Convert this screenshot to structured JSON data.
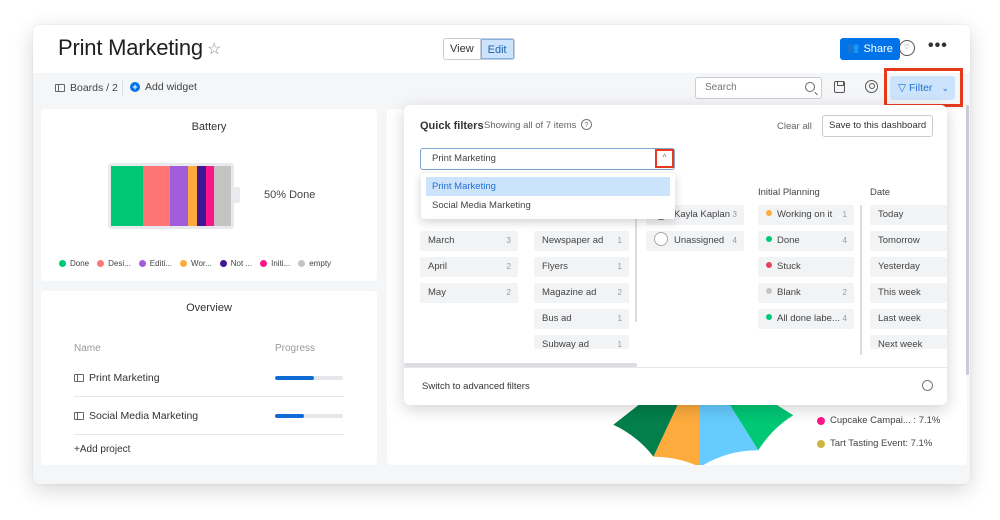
{
  "header": {
    "title": "Print Marketing",
    "view_label": "View",
    "edit_label": "Edit",
    "share_label": "Share"
  },
  "toolbar": {
    "boards_label": "Boards / 2",
    "add_widget_label": "Add widget",
    "search_placeholder": "Search",
    "filter_label": "Filter"
  },
  "battery_widget": {
    "title": "Battery",
    "done_label": "50% Done",
    "segments": [
      {
        "name": "Done",
        "color": "#00c875",
        "share": 0.27
      },
      {
        "name": "Desi...",
        "color": "#ff7575",
        "share": 0.22
      },
      {
        "name": "Editi...",
        "color": "#a25ddc",
        "share": 0.15
      },
      {
        "name": "Wor...",
        "color": "#fdab3d",
        "share": 0.08
      },
      {
        "name": "Not ...",
        "color": "#401694",
        "share": 0.07
      },
      {
        "name": "Initi...",
        "color": "#ff158a",
        "share": 0.07
      },
      {
        "name": "empty",
        "color": "#c4c4c4",
        "share": 0.14
      }
    ]
  },
  "overview_widget": {
    "title": "Overview",
    "col_name": "Name",
    "col_progress": "Progress",
    "rows": [
      {
        "name": "Print Marketing",
        "progress": 0.58
      },
      {
        "name": "Social Media Marketing",
        "progress": 0.43
      }
    ],
    "add_project_label": "+Add project"
  },
  "pie_widget": {
    "legend": [
      {
        "label": "Cupcake Campai... : 7.1%",
        "color": "#ff158a"
      },
      {
        "label": "Tart Tasting Event: 7.1%",
        "color": "#cab641"
      }
    ],
    "visible_slices": [
      {
        "color": "#037f4c"
      },
      {
        "color": "#fdab3d"
      },
      {
        "color": "#66ccff"
      },
      {
        "color": "#00c875"
      }
    ]
  },
  "quick_filters": {
    "title": "Quick filters",
    "subtitle": "Showing all of 7 items",
    "clear_all_label": "Clear all",
    "save_label": "Save to this dashboard",
    "board_select_value": "Print Marketing",
    "dropdown_options": [
      "Print Marketing",
      "Social Media Marketing"
    ],
    "columns": [
      {
        "header": "",
        "items": [
          {
            "label": "March",
            "count": "3"
          },
          {
            "label": "April",
            "count": "2"
          },
          {
            "label": "May",
            "count": "2"
          }
        ]
      },
      {
        "header": "",
        "items": [
          {
            "label": "Newspaper ad",
            "count": "1"
          },
          {
            "label": "Flyers",
            "count": "1"
          },
          {
            "label": "Magazine ad",
            "count": "2"
          },
          {
            "label": "Bus ad",
            "count": "1"
          },
          {
            "label": "Subway ad",
            "count": "1"
          }
        ]
      },
      {
        "header": "",
        "items": [
          {
            "label": "Kayla Kaplan",
            "count": "3"
          },
          {
            "label": "Unassigned",
            "count": "4"
          }
        ]
      },
      {
        "header": "Initial Planning",
        "items": [
          {
            "label": "Working on it",
            "count": "1",
            "color": "#fdab3d"
          },
          {
            "label": "Done",
            "count": "4",
            "color": "#00c875"
          },
          {
            "label": "Stuck",
            "count": "",
            "color": "#e2445c"
          },
          {
            "label": "Blank",
            "count": "2",
            "color": "#c4c4c4"
          },
          {
            "label": "All done labe...",
            "count": "4",
            "color": "#00c875"
          }
        ]
      },
      {
        "header": "Date",
        "items": [
          {
            "label": "Today"
          },
          {
            "label": "Tomorrow"
          },
          {
            "label": "Yesterday"
          },
          {
            "label": "This week"
          },
          {
            "label": "Last week"
          },
          {
            "label": "Next week"
          }
        ]
      }
    ],
    "advanced_label": "Switch to advanced filters"
  },
  "colors": {
    "accent": "#0073ea",
    "highlight": "#e53a1e",
    "selected_bg": "#cce4fb"
  }
}
